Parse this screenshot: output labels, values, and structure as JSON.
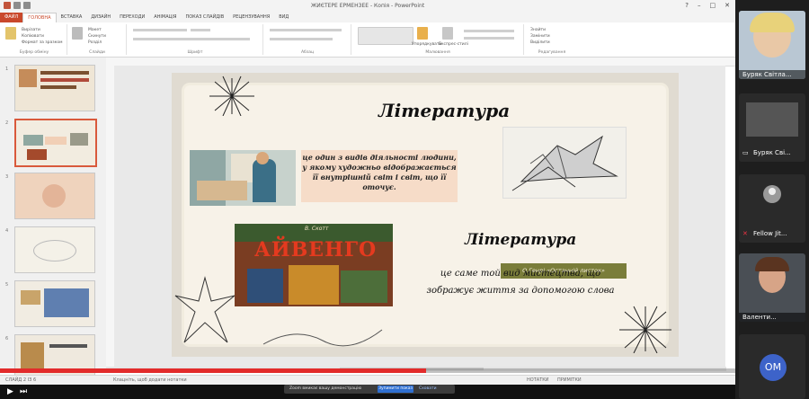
{
  "window": {
    "title": "ЖИЄТЕРЕ ЕРМЕНЗЕЕ - Копія - PowerPoint",
    "controls": [
      "?",
      "–",
      "□",
      "✕"
    ]
  },
  "ribbon": {
    "tabs": [
      "ФАЙЛ",
      "ГОЛОВНА",
      "ВСТАВКА",
      "ДИЗАЙН",
      "ПЕРЕХОДИ",
      "АНІМАЦІЯ",
      "ПОКАЗ СЛАЙДІВ",
      "РЕЦЕНЗУВАННЯ",
      "ВИД"
    ],
    "active_tab": "ГОЛОВНА",
    "groups": [
      "Буфер обміну",
      "Слайди",
      "Шрифт",
      "Абзац",
      "Малювання",
      "Редагування"
    ],
    "clipboard_items": [
      "Вирізати",
      "Копіювати",
      "Формат за зразком"
    ],
    "slides_items": [
      "Макет",
      "Скинути",
      "Розділ"
    ],
    "editing_items": [
      "Знайти",
      "Замінити",
      "Виділити"
    ],
    "arrange_label": "Упорядкувати",
    "styles_label": "Експрес-стилі"
  },
  "thumbnails": [
    "1",
    "2",
    "3",
    "4",
    "5",
    "6"
  ],
  "slide": {
    "title1": "Література",
    "definition": "це один з видів діяльності людини, у якому художньо відображається її внутрішній світ і світ, що її оточує.",
    "caption": "О.Генрі «Останній листок»",
    "book_author": "В. Скотт",
    "book_title": "АЙВЕНГО",
    "title2": "Література",
    "body": "це саме той вид мистецтва, що зображує життя за допомогою слова"
  },
  "status": {
    "left": "СЛАЙД 2 ІЗ 6",
    "notes": "Клацніть, щоб додати нотатки",
    "right_notes": "НОТАТКИ",
    "comments": "ПРИМІТКИ"
  },
  "notice": {
    "message": "Zoom вмикає вашу демонстрацію",
    "stop": "Зупинити показ",
    "hide": "Сховати"
  },
  "participants": [
    {
      "name": "Буряк Світла...",
      "type": "video",
      "icon": "microphone-muted-icon"
    },
    {
      "name": "Буряк Сві...",
      "type": "screen",
      "icon": "screen-share-icon"
    },
    {
      "name": "Fellow Jit...",
      "type": "avatar",
      "icon": "microphone-muted-icon"
    },
    {
      "name": "Валенти...",
      "type": "video",
      "icon": "microphone-muted-icon"
    },
    {
      "name": "",
      "type": "initials",
      "initials": "ОМ"
    }
  ],
  "video": {
    "progress": 0.58
  },
  "colors": {
    "accent": "#c9482b",
    "progress": "#e22b2b",
    "caption_bg": "#7a7d3a"
  }
}
